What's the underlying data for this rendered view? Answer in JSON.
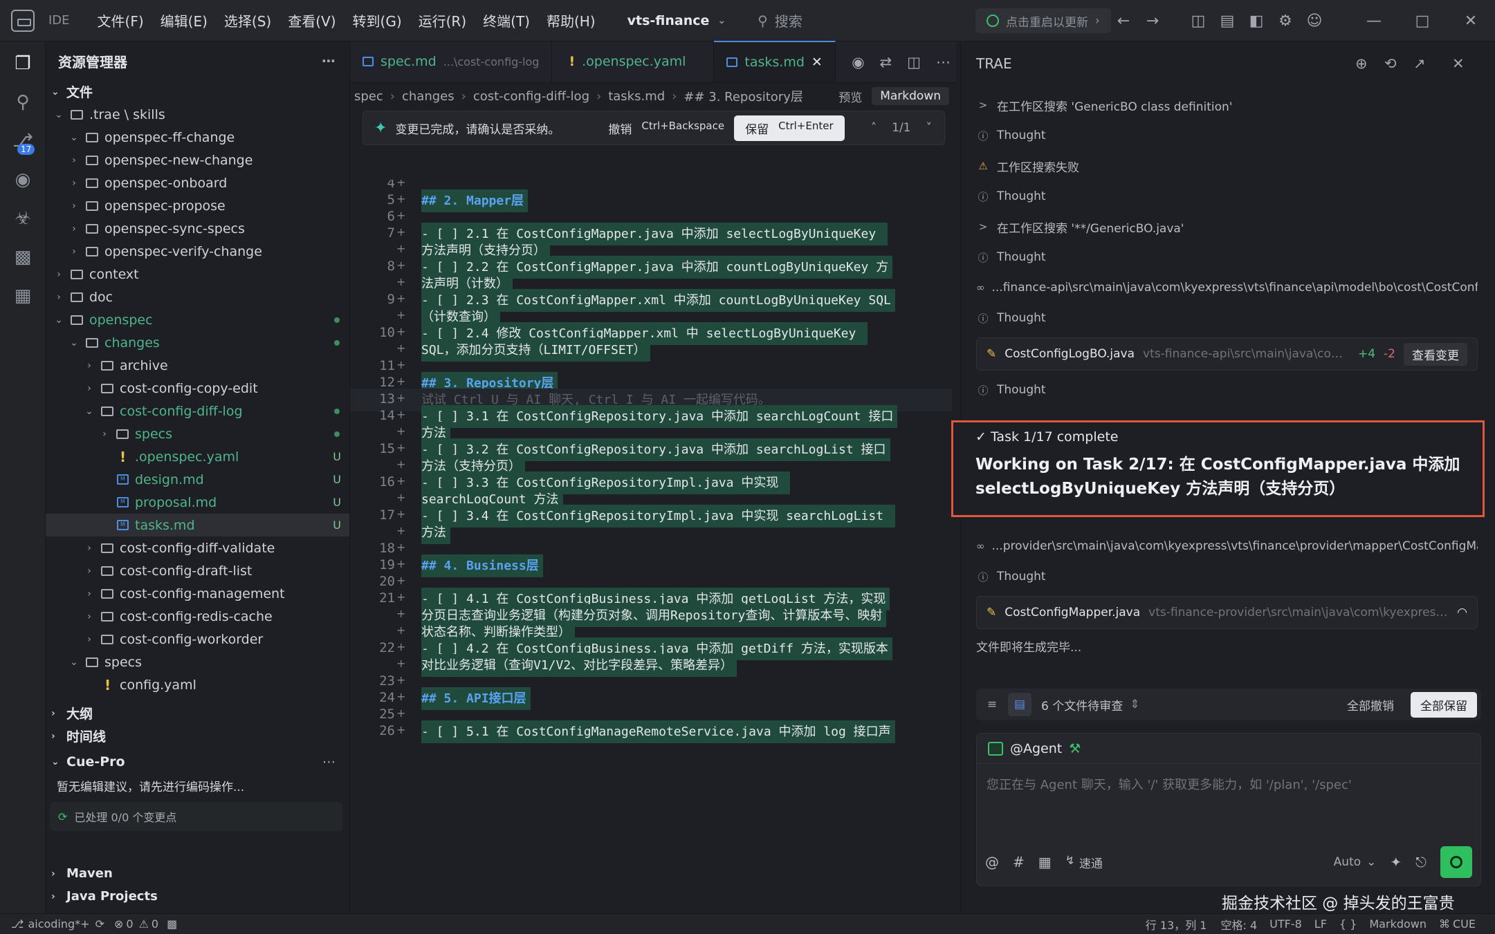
{
  "titlebar": {
    "ide": "IDE",
    "menu": [
      "文件(F)",
      "编辑(E)",
      "选择(S)",
      "查看(V)",
      "转到(G)",
      "运行(R)",
      "终端(T)",
      "帮助(H)"
    ],
    "project": "vts-finance",
    "search": "搜索",
    "update": "点击重启以更新"
  },
  "activity": {
    "badge": "17"
  },
  "explorer": {
    "title": "资源管理器",
    "root": "文件",
    "tree": [
      {
        "label": ".trae \\ skills",
        "depth": 0,
        "open": true,
        "kind": "folder"
      },
      {
        "label": "openspec-ff-change",
        "depth": 1,
        "open": true,
        "kind": "folder"
      },
      {
        "label": "openspec-new-change",
        "depth": 1,
        "kind": "folder"
      },
      {
        "label": "openspec-onboard",
        "depth": 1,
        "kind": "folder"
      },
      {
        "label": "openspec-propose",
        "depth": 1,
        "kind": "folder"
      },
      {
        "label": "openspec-sync-specs",
        "depth": 1,
        "kind": "folder"
      },
      {
        "label": "openspec-verify-change",
        "depth": 1,
        "kind": "folder"
      },
      {
        "label": "context",
        "depth": 0,
        "kind": "folder"
      },
      {
        "label": "doc",
        "depth": 0,
        "kind": "folder"
      },
      {
        "label": "openspec",
        "depth": 0,
        "open": true,
        "kind": "folder",
        "green": true,
        "dot": true
      },
      {
        "label": "changes",
        "depth": 1,
        "open": true,
        "kind": "folder",
        "green": true,
        "dot": true
      },
      {
        "label": "archive",
        "depth": 2,
        "kind": "folder"
      },
      {
        "label": "cost-config-copy-edit",
        "depth": 2,
        "kind": "folder"
      },
      {
        "label": "cost-config-diff-log",
        "depth": 2,
        "open": true,
        "kind": "folder",
        "green": true,
        "dot": true
      },
      {
        "label": "specs",
        "depth": 3,
        "kind": "folder",
        "green": true,
        "dot": true
      },
      {
        "label": ".openspec.yaml",
        "depth": 3,
        "kind": "yaml",
        "green": true,
        "u": "U"
      },
      {
        "label": "design.md",
        "depth": 3,
        "kind": "md",
        "green": true,
        "u": "U"
      },
      {
        "label": "proposal.md",
        "depth": 3,
        "kind": "md",
        "green": true,
        "u": "U"
      },
      {
        "label": "tasks.md",
        "depth": 3,
        "kind": "md",
        "green": true,
        "u": "U",
        "selected": true
      },
      {
        "label": "cost-config-diff-validate",
        "depth": 2,
        "kind": "folder"
      },
      {
        "label": "cost-config-draft-list",
        "depth": 2,
        "kind": "folder"
      },
      {
        "label": "cost-config-management",
        "depth": 2,
        "kind": "folder"
      },
      {
        "label": "cost-config-redis-cache",
        "depth": 2,
        "kind": "folder"
      },
      {
        "label": "cost-config-workorder",
        "depth": 2,
        "kind": "folder"
      },
      {
        "label": "specs",
        "depth": 1,
        "open": true,
        "kind": "folder"
      },
      {
        "label": "config.yaml",
        "depth": 2,
        "kind": "yaml"
      }
    ],
    "outline": "大纲",
    "timeline": "时间线",
    "cue": "Cue-Pro",
    "cue_msg": "暂无编辑建议，请先进行编码操作...",
    "cue_done": "已处理 0/0 个变更点",
    "maven": "Maven",
    "java": "Java Projects"
  },
  "editor": {
    "tabs": [
      {
        "label": "spec.md",
        "sub": "...\\cost-config-log"
      },
      {
        "label": ".openspec.yaml",
        "sub": ""
      },
      {
        "label": "tasks.md",
        "sub": "",
        "active": true
      }
    ],
    "crumbs": [
      "spec",
      "changes",
      "cost-config-diff-log",
      "tasks.md",
      "## 3. Repository层"
    ],
    "preview": "预览",
    "lang": "Markdown",
    "notif": {
      "text": "变更已完成，请确认是否采纳。",
      "undo": "撤销",
      "undo_key": "Ctrl+Backspace",
      "keep": "保留",
      "keep_key": "Ctrl+Enter",
      "count": "1/1"
    },
    "lines": [
      {
        "n": "4",
        "parts": []
      },
      {
        "n": "5",
        "parts": [
          "## 2. Mapper层"
        ],
        "h": true
      },
      {
        "n": "6",
        "parts": []
      },
      {
        "n": "7",
        "parts": [
          "- [ ] 2.1 在 CostConfigMapper.java 中添加 selectLogByUniqueKey ",
          "方法声明（支持分页）"
        ]
      },
      {
        "n": "8",
        "parts": [
          "- [ ] 2.2 在 CostConfigMapper.java 中添加 countLogByUniqueKey 方",
          "法声明（计数）"
        ]
      },
      {
        "n": "9",
        "parts": [
          "- [ ] 2.3 在 CostConfigMapper.xml 中添加 countLogByUniqueKey SQL",
          "（计数查询）"
        ]
      },
      {
        "n": "10",
        "parts": [
          "- [ ] 2.4 修改 CostConfigMapper.xml 中 selectLogByUniqueKey ",
          "SQL，添加分页支持（LIMIT/OFFSET）"
        ]
      },
      {
        "n": "11",
        "parts": []
      },
      {
        "n": "12",
        "parts": [
          "## 3. Repository层"
        ],
        "h": true
      },
      {
        "n": "13",
        "parts": [
          "试试 Ctrl U 与 AI 聊天, Ctrl I 与 AI 一起编写代码。"
        ],
        "ghost": true
      },
      {
        "n": "14",
        "parts": [
          "- [ ] 3.1 在 CostConfigRepository.java 中添加 searchLogCount 接口",
          "方法"
        ]
      },
      {
        "n": "15",
        "parts": [
          "- [ ] 3.2 在 CostConfigRepository.java 中添加 searchLogList 接口",
          "方法（支持分页）"
        ]
      },
      {
        "n": "16",
        "parts": [
          "- [ ] 3.3 在 CostConfigRepositoryImpl.java 中实现 ",
          "searchLogCount 方法"
        ]
      },
      {
        "n": "17",
        "parts": [
          "- [ ] 3.4 在 CostConfigRepositoryImpl.java 中实现 searchLogList ",
          "方法"
        ]
      },
      {
        "n": "18",
        "parts": []
      },
      {
        "n": "19",
        "parts": [
          "## 4. Business层"
        ],
        "h": true
      },
      {
        "n": "20",
        "parts": []
      },
      {
        "n": "21",
        "parts": [
          "- [ ] 4.1 在 CostConfigBusiness.java 中添加 getLogList 方法，实现",
          "分页日志查询业务逻辑（构建分页对象、调用Repository查询、计算版本号、映射",
          "状态名称、判断操作类型）"
        ]
      },
      {
        "n": "22",
        "parts": [
          "- [ ] 4.2 在 CostConfigBusiness.java 中添加 getDiff 方法，实现版本",
          "对比业务逻辑（查询V1/V2、对比字段差异、策略差异）"
        ]
      },
      {
        "n": "23",
        "parts": []
      },
      {
        "n": "24",
        "parts": [
          "## 5. API接口层"
        ],
        "h": true
      },
      {
        "n": "25",
        "parts": []
      },
      {
        "n": "26",
        "parts": [
          "- [ ] 5.1 在 CostConfigManageRemoteService.java 中添加 log 接口声"
        ]
      }
    ]
  },
  "panel": {
    "title": "TRAE",
    "steps_top": [
      {
        "icon": ">",
        "text": "在工作区搜索 'GenericBO class definition'"
      },
      {
        "icon": "ⓘ",
        "text": "Thought"
      },
      {
        "icon": "⚠",
        "text": "工作区搜索失败",
        "warn": true
      },
      {
        "icon": "ⓘ",
        "text": "Thought"
      },
      {
        "icon": ">",
        "text": "在工作区搜索 '**/GenericBO.java'"
      },
      {
        "icon": "ⓘ",
        "text": "Thought"
      },
      {
        "icon": "∞",
        "text": "...finance-api\\src\\main\\java\\com\\kyexpress\\vts\\finance\\api\\model\\bo\\cost\\CostConfigBO.java"
      },
      {
        "icon": "ⓘ",
        "text": "Thought"
      }
    ],
    "card1": {
      "file": "CostConfigLogBO.java",
      "path": "vts-finance-api\\src\\main\\java\\com\\kye...",
      "plus": "+4",
      "minus": "-2",
      "btn": "查看变更"
    },
    "thought_after_card": "Thought",
    "task_done": "✓ Task 1/17 complete",
    "task_working": "Working on Task 2/17: 在 CostConfigMapper.java 中添加 selectLogByUniqueKey 方法声明（支持分页）",
    "steps_bottom": [
      {
        "icon": "∞",
        "text": "...provider\\src\\main\\java\\com\\kyexpress\\vts\\finance\\provider\\mapper\\CostConfigMapper.java"
      },
      {
        "icon": "ⓘ",
        "text": "Thought"
      }
    ],
    "card2": {
      "file": "CostConfigMapper.java",
      "path": "vts-finance-provider\\src\\main\\java\\com\\kyexpress\\vts..."
    },
    "generating": "文件即将生成完毕...",
    "review": {
      "text": "6 个文件待审查",
      "undo_all": "全部撤销",
      "keep_all": "全部保留"
    },
    "chat": {
      "agent": "@Agent",
      "placeholder": "您正在与 Agent 聊天，输入 '/' 获取更多能力，如 '/plan', '/spec'",
      "speed": "速通",
      "model": "Auto"
    }
  },
  "status": {
    "branch": "aicoding*+",
    "errors": "0",
    "warnings": "0",
    "position": "行 13，列 1",
    "spaces": "空格: 4",
    "encoding": "UTF-8",
    "eol": "LF",
    "braces": "{ }",
    "lang": "Markdown",
    "cue": "CUE"
  },
  "watermark": "掘金技术社区 @ 掉头发的王富贵"
}
